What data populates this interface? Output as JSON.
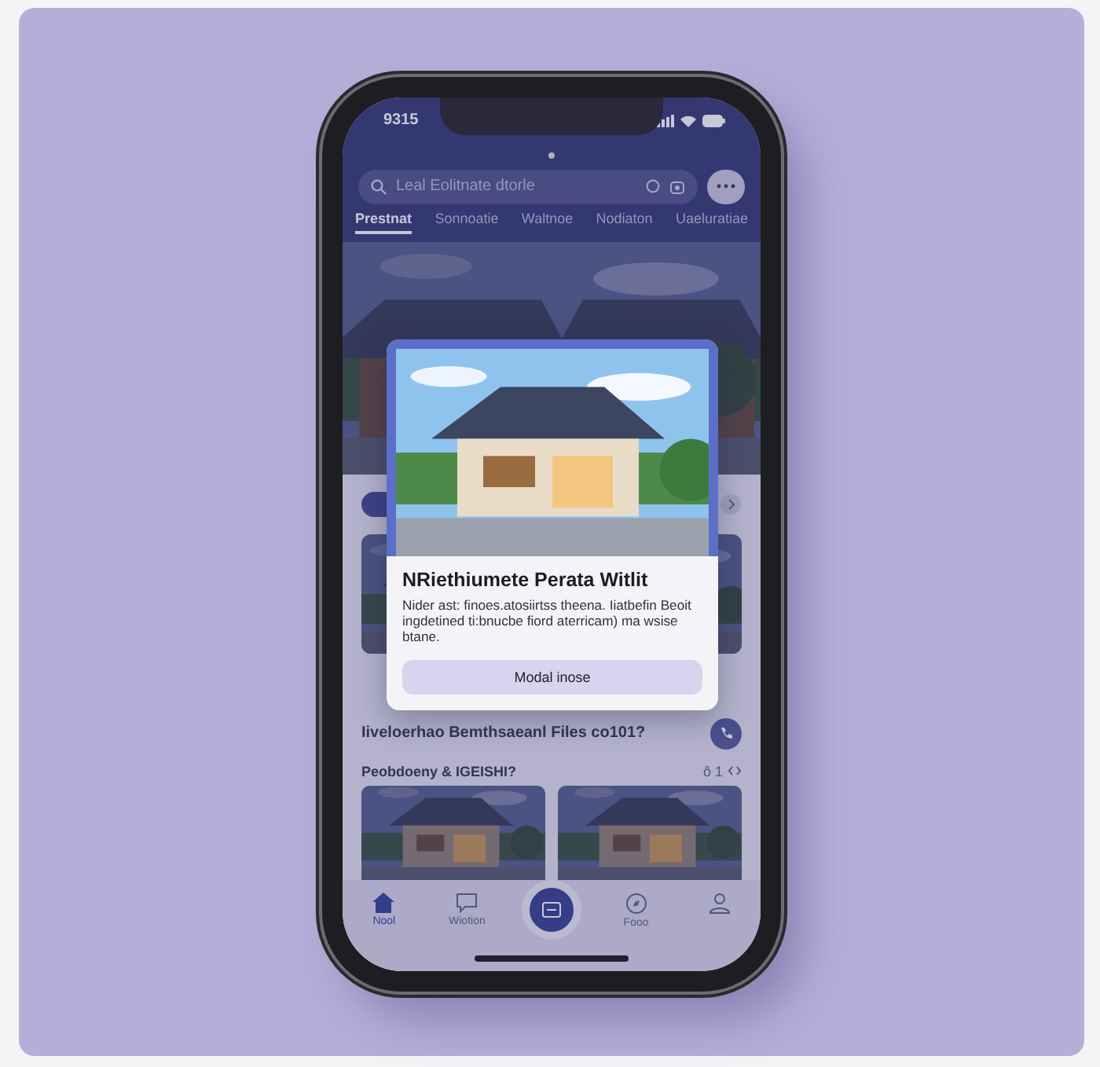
{
  "status_bar": {
    "time": "9315"
  },
  "search": {
    "placeholder": "Leal Eolitnate dtorle"
  },
  "tabs": [
    {
      "label": "Prestnat",
      "selected": true
    },
    {
      "label": "Sonnoatie",
      "selected": false
    },
    {
      "label": "Waltnoe",
      "selected": false
    },
    {
      "label": "Nodiaton",
      "selected": false
    },
    {
      "label": "Uaeluratiae",
      "selected": false
    }
  ],
  "sections": [
    {
      "title": "Iiveloerhao Bemthsaeanl Files co101?"
    },
    {
      "title": "Peobdoeny & IGEISHI?",
      "count": "ô 1"
    }
  ],
  "nav": [
    {
      "kind": "home",
      "label": "Nool",
      "selected": true
    },
    {
      "kind": "chat",
      "label": "Wiotion",
      "selected": false
    },
    {
      "kind": "fab",
      "selected": false
    },
    {
      "kind": "compass",
      "label": "Fooo",
      "selected": false
    },
    {
      "kind": "profile",
      "selected": false
    }
  ],
  "modal": {
    "title": "NRiethiumete Perata Witlit",
    "body": "Nider ast: finoes.atosiirtss theena. Iiatbefin Beoit ingdetined ti:bnucbe fiord aterricam) ma wsise btane.",
    "button": "Modal inose"
  }
}
